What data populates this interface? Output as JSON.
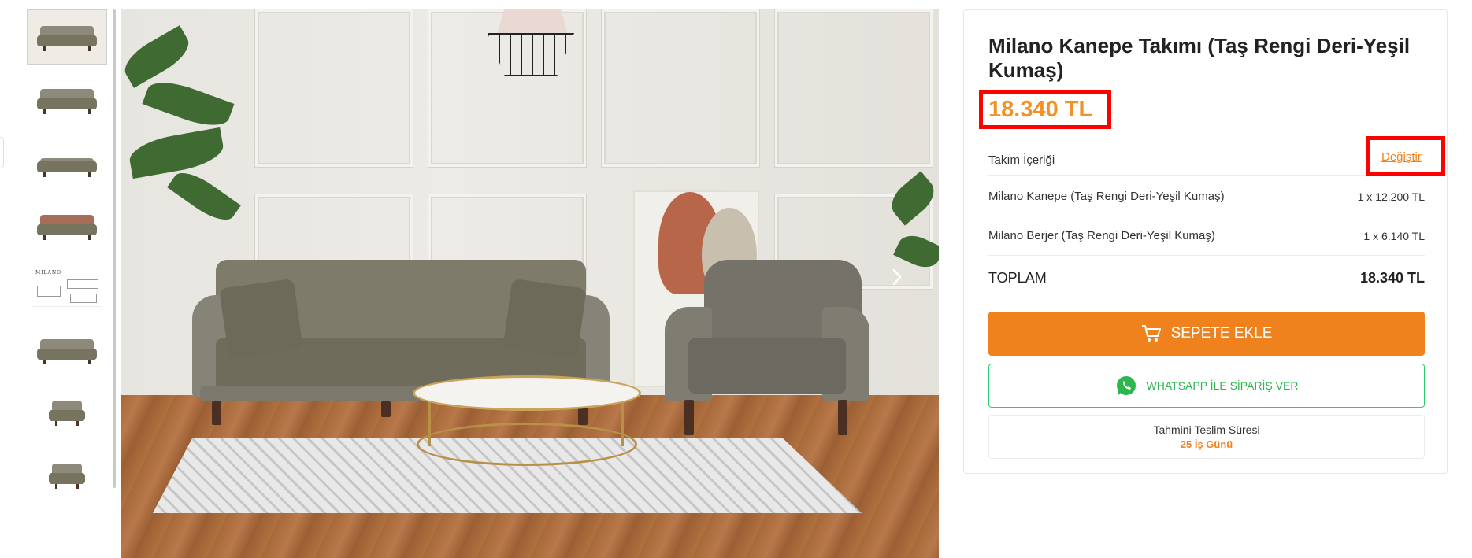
{
  "product": {
    "title": "Milano Kanepe Takımı (Taş Rengi Deri-Yeşil Kumaş)",
    "price": "18.340 TL"
  },
  "set_contents": {
    "header": "Takım İçeriği",
    "change_link": "Değiştir",
    "items": [
      {
        "name": "Milano Kanepe (Taş Rengi Deri-Yeşil Kumaş)",
        "qty": "1 x 12.200 TL"
      },
      {
        "name": "Milano Berjer (Taş Rengi Deri-Yeşil Kumaş)",
        "qty": "1 x 6.140 TL"
      }
    ],
    "total_label": "TOPLAM",
    "total_value": "18.340 TL"
  },
  "actions": {
    "add_to_cart": "SEPETE EKLE",
    "whatsapp": "WHATSAPP İLE SİPARİŞ VER"
  },
  "delivery": {
    "label": "Tahmini Teslim Süresi",
    "value": "25 İş Günü"
  },
  "gallery": {
    "thumb_logo_text": "MILANO",
    "icons": [
      "chevron-right-icon",
      "cart-icon",
      "whatsapp-icon"
    ]
  },
  "colors": {
    "accent": "#f0821e",
    "price": "#f39124",
    "whatsapp": "#2bb74e",
    "highlight": "#ff0000"
  }
}
